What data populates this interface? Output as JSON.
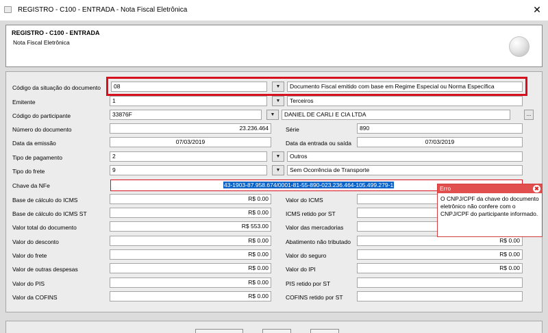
{
  "window": {
    "title": "REGISTRO - C100 - ENTRADA - Nota Fiscal Eletrônica",
    "close_glyph": "✕"
  },
  "header": {
    "title": "REGISTRO - C100 - ENTRADA",
    "subtitle": "Nota Fiscal Eletrônica"
  },
  "form": {
    "situacao": {
      "label": "Código da situação do documento",
      "code": "08",
      "desc": "Documento Fiscal emitido com base em Regime Especial ou Norma Específica"
    },
    "emitente": {
      "label": "Emitente",
      "code": "1",
      "desc": "Terceiros"
    },
    "participante": {
      "label": "Código do participante",
      "code": "33876F",
      "desc": "DANIEL DE CARLI E CIA LTDA",
      "more": "..."
    },
    "numero": {
      "label": "Número do documento",
      "value": "23.236.464"
    },
    "serie": {
      "label": "Série",
      "value": "890"
    },
    "data_emissao": {
      "label": "Data da emissão",
      "value": "07/03/2019"
    },
    "data_entrada": {
      "label": "Data da entrada ou saída",
      "value": "07/03/2019"
    },
    "pagamento": {
      "label": "Tipo de pagamento",
      "code": "2",
      "desc": "Outros"
    },
    "frete": {
      "label": "Tipo do frete",
      "code": "9",
      "desc": "Sem Ocorrência de Transporte"
    },
    "chave": {
      "label": "Chave da NFe",
      "value": "43-1903-87.958.674/0001-81-55-890-023.236.464-105.499.279-1"
    },
    "left_values": [
      {
        "label": "Base de cálculo do ICMS",
        "value": "R$ 0.00"
      },
      {
        "label": "Base de cálculo do ICMS ST",
        "value": "R$ 0.00"
      },
      {
        "label": "Valor total do documento",
        "value": "R$ 553.00"
      },
      {
        "label": "Valor do desconto",
        "value": "R$ 0.00"
      },
      {
        "label": "Valor do frete",
        "value": "R$ 0.00"
      },
      {
        "label": "Valor de outras despesas",
        "value": "R$ 0.00"
      },
      {
        "label": "Valor do PIS",
        "value": "R$ 0.00"
      },
      {
        "label": "Valor da COFINS",
        "value": "R$ 0.00"
      }
    ],
    "right_values": [
      {
        "label": "Valor do ICMS",
        "value": ""
      },
      {
        "label": "ICMS retido por ST",
        "value": ""
      },
      {
        "label": "Valor das mercadorias",
        "value": ""
      },
      {
        "label": "Abatimento não tributado",
        "value": "R$ 0.00"
      },
      {
        "label": "Valor do seguro",
        "value": "R$ 0.00"
      },
      {
        "label": "Valor do IPI",
        "value": "R$ 0.00"
      },
      {
        "label": "PIS retido por ST",
        "value": ""
      },
      {
        "label": "COFINS retido por ST",
        "value": ""
      }
    ],
    "dropdown_glyph": "▼"
  },
  "error_tooltip": {
    "title": "Erro",
    "close_glyph": "✖",
    "message": "O CNPJ/CPF da chave do documento eletrônico não confere com o CNPJ/CPF do participante informado."
  },
  "colors": {
    "highlight_red": "#d8101e",
    "selection_blue": "#0a63c9",
    "error_header": "#e24f4f"
  }
}
